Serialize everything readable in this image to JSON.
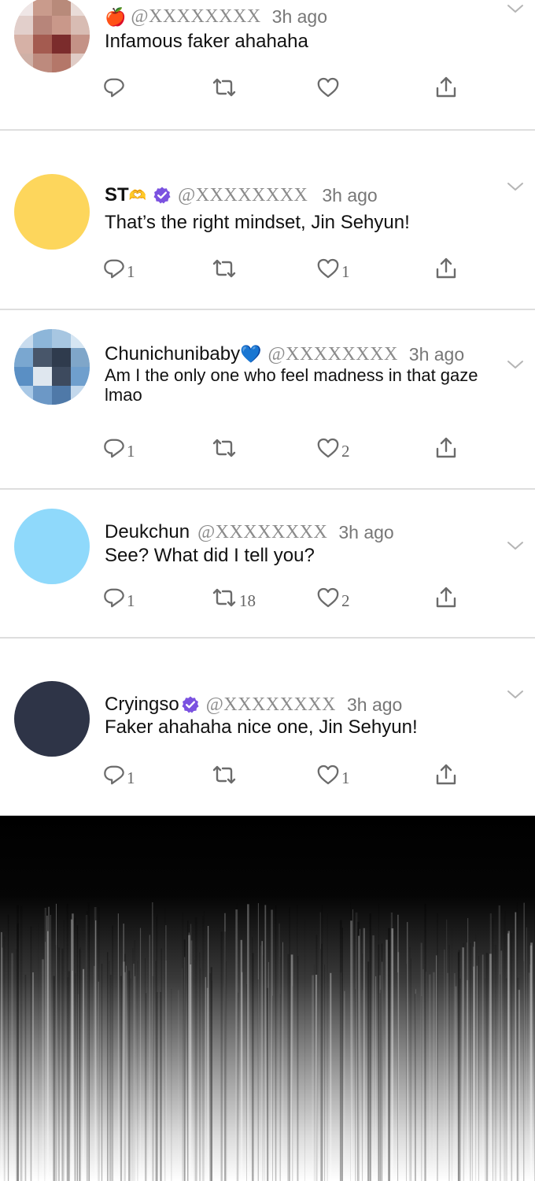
{
  "tweets": [
    {
      "name": "",
      "emoji": "🍎",
      "handle": "@XXXXXXXX",
      "time": "3h ago",
      "text": "Infamous faker ahahaha",
      "replies": "",
      "retweets": "",
      "likes": ""
    },
    {
      "name": "ST",
      "emoji": "🫶",
      "verified": true,
      "handle": "@XXXXXXXX",
      "time": "3h ago",
      "text": "That’s the right mindset, Jin Sehyun!",
      "replies": "1",
      "retweets": "",
      "likes": "1"
    },
    {
      "name": "Chunichunibaby",
      "emoji": "💙",
      "handle": "@XXXXXXXX",
      "time": "3h ago",
      "text": "Am I the only one who feel madness in that gaze lmao",
      "replies": "1",
      "retweets": "",
      "likes": "2"
    },
    {
      "name": "Deukchun",
      "handle": "@XXXXXXXX",
      "time": "3h ago",
      "text": "See? What did I tell you?",
      "replies": "1",
      "retweets": "18",
      "likes": "2"
    },
    {
      "name": "Cryingso",
      "verified": true,
      "handle": "@XXXXXXXX",
      "time": "3h ago",
      "text": "Faker ahahaha nice one, Jin Sehyun!",
      "replies": "1",
      "retweets": "",
      "likes": "1"
    }
  ],
  "colors": {
    "avatar_yellow": "#fdd65c",
    "avatar_lightblue": "#8fd9fb",
    "avatar_navy": "#2e3447",
    "verified_purple": "#7b52e0",
    "icon_gray": "#6b6b6b"
  },
  "icons": [
    "reply-icon",
    "retweet-icon",
    "like-icon",
    "share-icon",
    "chevron-down-icon",
    "verified-badge-icon"
  ]
}
